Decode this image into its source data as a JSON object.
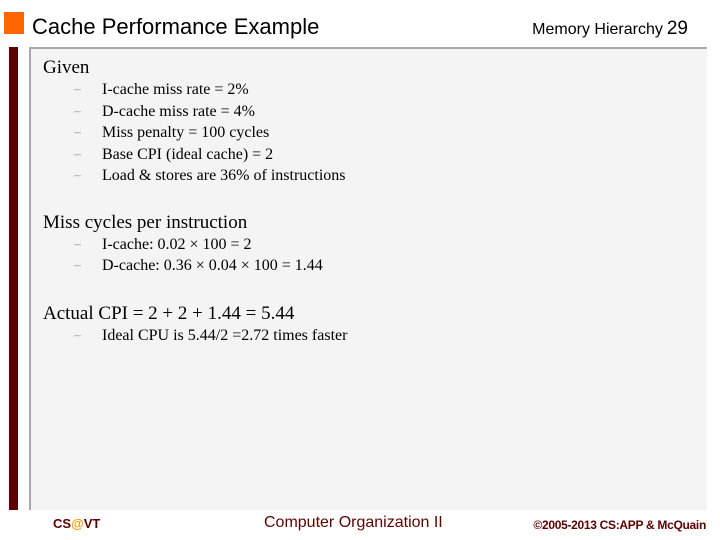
{
  "header": {
    "title": "Cache Performance Example",
    "section": "Memory Hierarchy",
    "page_number": "29"
  },
  "body": {
    "sections": [
      {
        "heading": "Given",
        "items": [
          "I-cache miss rate = 2%",
          "D-cache miss rate = 4%",
          "Miss penalty = 100 cycles",
          "Base CPI (ideal cache) = 2",
          "Load & stores are 36% of instructions"
        ]
      },
      {
        "heading": "Miss cycles per instruction",
        "items": [
          "I-cache: 0.02 × 100 = 2",
          "D-cache: 0.36 × 0.04 × 100 = 1.44"
        ]
      },
      {
        "heading": "Actual CPI = 2 + 2 + 1.44 = 5.44",
        "items": [
          "Ideal CPU is 5.44/2 =2.72 times faster"
        ]
      }
    ],
    "bullet_glyph": "–"
  },
  "footer": {
    "left_prefix": "CS",
    "left_at": "@",
    "left_suffix": "VT",
    "center": "Computer Organization II",
    "right": "©2005-2013 CS:APP & McQuain"
  },
  "colors": {
    "accent_orange": "#ff6600",
    "maroon": "#5c0000",
    "panel_bg": "#f4f4f4"
  }
}
